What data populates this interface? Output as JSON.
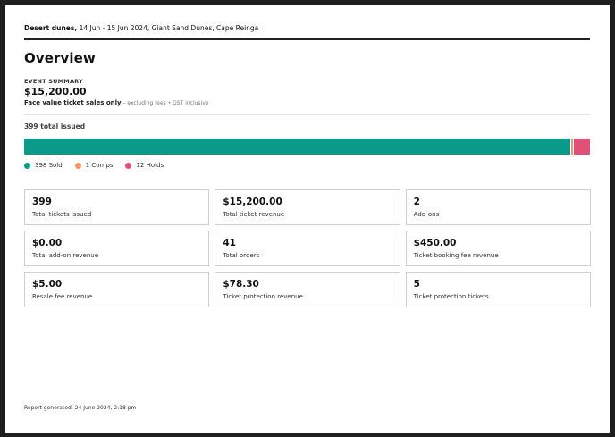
{
  "header": {
    "event_name": "Desert dunes,",
    "event_details": " 14 Jun - 15 Jun 2024, Giant Sand Dunes, Cape Reinga"
  },
  "title": "Overview",
  "summary": {
    "label": "EVENT SUMMARY",
    "amount": "$15,200.00",
    "note_strong": "Face value ticket sales only",
    "note_light": " – excluding fees • GST inclusive"
  },
  "issued": {
    "label": "399 total issued",
    "segments": [
      {
        "label": "398 Sold",
        "count": 398,
        "color": "#0a9a8a"
      },
      {
        "label": "1 Comps",
        "count": 1,
        "color": "#f4966a"
      },
      {
        "label": "12 Holds",
        "count": 12,
        "color": "#e05177"
      }
    ]
  },
  "stats": [
    {
      "value": "399",
      "label": "Total tickets issued"
    },
    {
      "value": "$15,200.00",
      "label": "Total ticket revenue"
    },
    {
      "value": "2",
      "label": "Add-ons"
    },
    {
      "value": "$0.00",
      "label": "Total add-on revenue"
    },
    {
      "value": "41",
      "label": "Total orders"
    },
    {
      "value": "$450.00",
      "label": "Ticket booking fee revenue"
    },
    {
      "value": "$5.00",
      "label": "Resale fee revenue"
    },
    {
      "value": "$78.30",
      "label": "Ticket protection revenue"
    },
    {
      "value": "5",
      "label": "Ticket protection tickets"
    }
  ],
  "footer": "Report generated: 24 June 2024, 2:18 pm"
}
